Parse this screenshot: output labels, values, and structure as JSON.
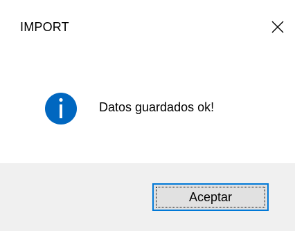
{
  "window": {
    "title": "IMPORT"
  },
  "message": {
    "text": "Datos guardados ok!",
    "icon": "information-icon",
    "icon_color": "#0067c0"
  },
  "buttons": {
    "ok_label": "Aceptar",
    "accent": "#0078d7"
  },
  "icons": {
    "close": "close-icon"
  }
}
